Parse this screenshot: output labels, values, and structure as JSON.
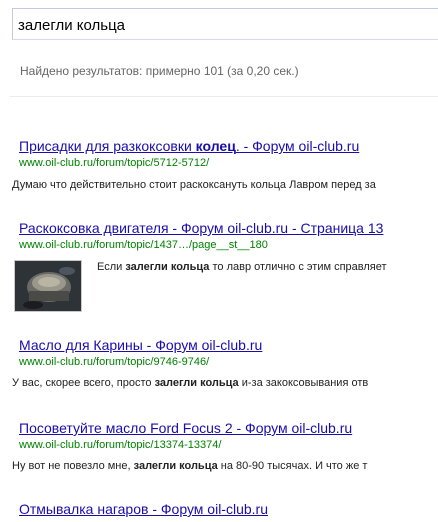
{
  "search": {
    "query": "залегли кольца",
    "stats": "Найдено результатов: примерно 101 (за 0,20 сек.)"
  },
  "results": [
    {
      "title_pre": "Присадки для разкоксовки ",
      "title_bold": "колец",
      "title_post": ". - Форум oil-club.ru",
      "url": "www.oil-club.ru/forum/topic/5712-5712/",
      "snippet_pre": "Думаю что действительно стоит раскоксануть кольца Лавром перед за",
      "snippet_bold": "",
      "snippet_post": ""
    },
    {
      "title_pre": "Раскоксовка двигателя - Форум oil-club.ru - Страница 13",
      "title_bold": "",
      "title_post": "",
      "url": "www.oil-club.ru/forum/topic/1437…/page__st__180",
      "snippet_pre": "Если ",
      "snippet_bold": "залегли кольца",
      "snippet_post": " то лавр отлично с этим справляет"
    },
    {
      "title_pre": "Масло для Карины - Форум oil-club.ru",
      "title_bold": "",
      "title_post": "",
      "url": "www.oil-club.ru/forum/topic/9746-9746/",
      "snippet_pre": "У вас, скорее всего, просто ",
      "snippet_bold": "залегли кольца",
      "snippet_post": " и-за закоксовывания отв"
    },
    {
      "title_pre": "Посоветуйте масло Ford Focus 2 - Форум oil-club.ru",
      "title_bold": "",
      "title_post": "",
      "url": "www.oil-club.ru/forum/topic/13374-13374/",
      "snippet_pre": "Ну вот не повезло мне, ",
      "snippet_bold": "залегли кольца",
      "snippet_post": " на 80-90 тысячах. И что же т"
    },
    {
      "title_pre": "Отмывалка нагаров - Форум oil-club.ru",
      "title_bold": "",
      "title_post": "",
      "url": "",
      "snippet_pre": "",
      "snippet_bold": "",
      "snippet_post": ""
    }
  ],
  "thumbnail": {
    "icon": "engine-part-photo-thumbnail"
  }
}
